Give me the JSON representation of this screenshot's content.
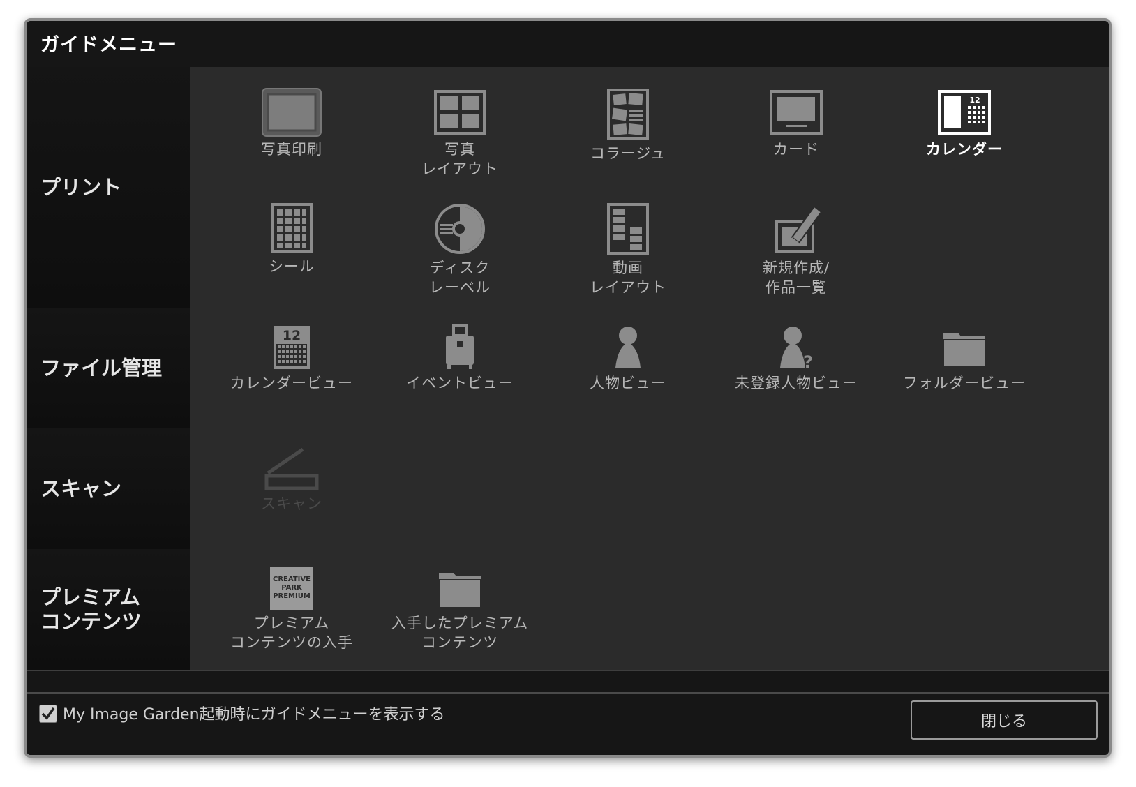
{
  "window": {
    "title": "ガイドメニュー"
  },
  "sections": {
    "print": {
      "label": "プリント",
      "items": [
        {
          "label": "写真印刷",
          "icon": "photo-print-icon"
        },
        {
          "label": "写真\nレイアウト",
          "icon": "photo-layout-icon"
        },
        {
          "label": "コラージュ",
          "icon": "collage-icon"
        },
        {
          "label": "カード",
          "icon": "card-icon"
        },
        {
          "label": "カレンダー",
          "icon": "calendar-icon",
          "selected": true
        },
        {
          "label": "シール",
          "icon": "sticker-icon"
        },
        {
          "label": "ディスク\nレーベル",
          "icon": "disc-label-icon"
        },
        {
          "label": "動画\nレイアウト",
          "icon": "video-layout-icon"
        },
        {
          "label": "新規作成/\n作品一覧",
          "icon": "new-creation-icon"
        }
      ]
    },
    "file": {
      "label": "ファイル管理",
      "items": [
        {
          "label": "カレンダービュー",
          "icon": "calendar-view-icon"
        },
        {
          "label": "イベントビュー",
          "icon": "event-view-icon"
        },
        {
          "label": "人物ビュー",
          "icon": "people-view-icon"
        },
        {
          "label": "未登録人物ビュー",
          "icon": "unregistered-people-icon"
        },
        {
          "label": "フォルダービュー",
          "icon": "folder-view-icon"
        }
      ]
    },
    "scan": {
      "label": "スキャン",
      "items": [
        {
          "label": "スキャン",
          "icon": "scanner-icon",
          "disabled": true
        }
      ]
    },
    "premium": {
      "label": "プレミアム\nコンテンツ",
      "items": [
        {
          "label": "プレミアム\nコンテンツの入手",
          "icon": "creative-park-premium-icon",
          "badge_text": [
            "CREATIVE",
            "PARK",
            "PREMIUM"
          ]
        },
        {
          "label": "入手したプレミアム\nコンテンツ",
          "icon": "downloaded-premium-folder-icon"
        }
      ]
    }
  },
  "footer": {
    "checkbox_label": "My Image Garden起動時にガイドメニューを表示する",
    "checkbox_checked": true,
    "close_label": "閉じる"
  },
  "colors": {
    "window_bg": "#161616",
    "panel_bg": "#2b2b2b",
    "label_text": "#b7b7b7",
    "selected_text": "#ffffff",
    "disabled_text": "#4a4a4a",
    "icon_gray": "#8c8c8c"
  }
}
